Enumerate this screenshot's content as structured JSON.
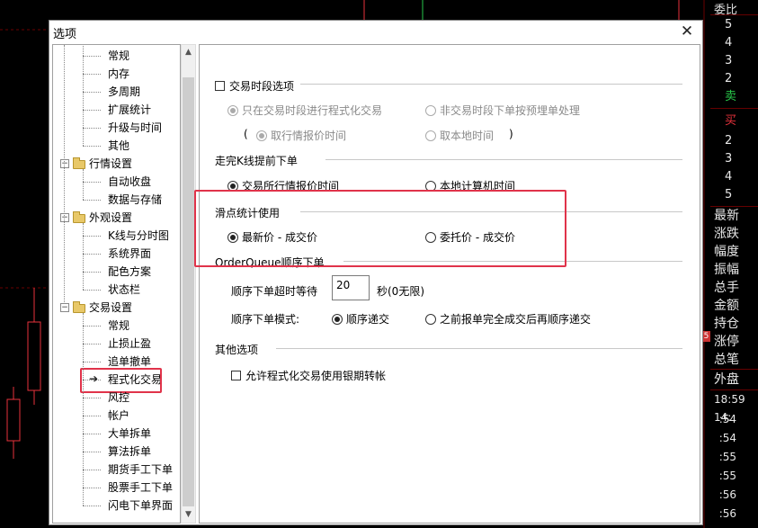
{
  "background": {
    "right_header": "委比",
    "order_book": {
      "sell_levels": [
        "5",
        "4",
        "3",
        "2"
      ],
      "sell_label": "卖",
      "buy_label": "买",
      "buy_levels": [
        "2",
        "3",
        "4",
        "5"
      ]
    },
    "quote_labels": [
      "最新",
      "涨跌",
      "幅度",
      "振幅",
      "总手",
      "金额",
      "持仓",
      "涨停",
      "总笔"
    ],
    "outer_label": "外盘",
    "time_header": "18:59",
    "time_header_extra": "14:",
    "times": [
      ":54",
      ":54",
      ":55",
      ":55",
      ":56",
      ":56"
    ],
    "marker_text": "5",
    "colors": {
      "up": "#e8323c",
      "down": "#29c94a",
      "accent": "#ffcc00"
    }
  },
  "dialog": {
    "title": "选项",
    "close_glyph": "✕"
  },
  "tree": {
    "items": [
      {
        "label": "常规",
        "type": "child"
      },
      {
        "label": "内存",
        "type": "child"
      },
      {
        "label": "多周期",
        "type": "child"
      },
      {
        "label": "扩展统计",
        "type": "child"
      },
      {
        "label": "升级与时间",
        "type": "child"
      },
      {
        "label": "其他",
        "type": "child"
      },
      {
        "label": "行情设置",
        "type": "group"
      },
      {
        "label": "自动收盘",
        "type": "child"
      },
      {
        "label": "数据与存储",
        "type": "child"
      },
      {
        "label": "外观设置",
        "type": "group"
      },
      {
        "label": "K线与分时图",
        "type": "child"
      },
      {
        "label": "系统界面",
        "type": "child"
      },
      {
        "label": "配色方案",
        "type": "child"
      },
      {
        "label": "状态栏",
        "type": "child"
      },
      {
        "label": "交易设置",
        "type": "group"
      },
      {
        "label": "常规",
        "type": "child"
      },
      {
        "label": "止损止盈",
        "type": "child"
      },
      {
        "label": "追单撤单",
        "type": "child"
      },
      {
        "label": "程式化交易",
        "type": "child",
        "selected": true
      },
      {
        "label": "风控",
        "type": "child"
      },
      {
        "label": "帐户",
        "type": "child"
      },
      {
        "label": "大单拆单",
        "type": "child"
      },
      {
        "label": "算法拆单",
        "type": "child"
      },
      {
        "label": "期货手工下单",
        "type": "child"
      },
      {
        "label": "股票手工下单",
        "type": "child"
      },
      {
        "label": "闪电下单界面",
        "type": "child"
      }
    ]
  },
  "settings": {
    "session": {
      "checkbox_label": "交易时段选项",
      "opt_in_session": "只在交易时段进行程式化交易",
      "opt_non_session": "非交易时段下单按预埋单处理",
      "paren_open": "(",
      "opt_quote_time": "取行情报价时间",
      "opt_local_time": "取本地时间",
      "paren_close": ")"
    },
    "kline": {
      "group_title": "走完K线提前下单",
      "opt_exchange_time": "交易所行情报价时间",
      "opt_local_computer": "本地计算机时间"
    },
    "slippage": {
      "group_title": "滑点统计使用",
      "opt_latest": "最新价 - 成交价",
      "opt_order": "委托价 - 成交价"
    },
    "queue": {
      "group_title": "OrderQueue顺序下单",
      "timeout_label": "顺序下单超时等待",
      "timeout_value": "20",
      "timeout_unit": "秒(0无限)",
      "mode_label": "顺序下单模式:",
      "opt_sequential": "顺序递交",
      "opt_after_complete": "之前报单完全成交后再顺序递交"
    },
    "other": {
      "group_title": "其他选项",
      "bank_transfer": "允许程式化交易使用银期转帐"
    }
  }
}
